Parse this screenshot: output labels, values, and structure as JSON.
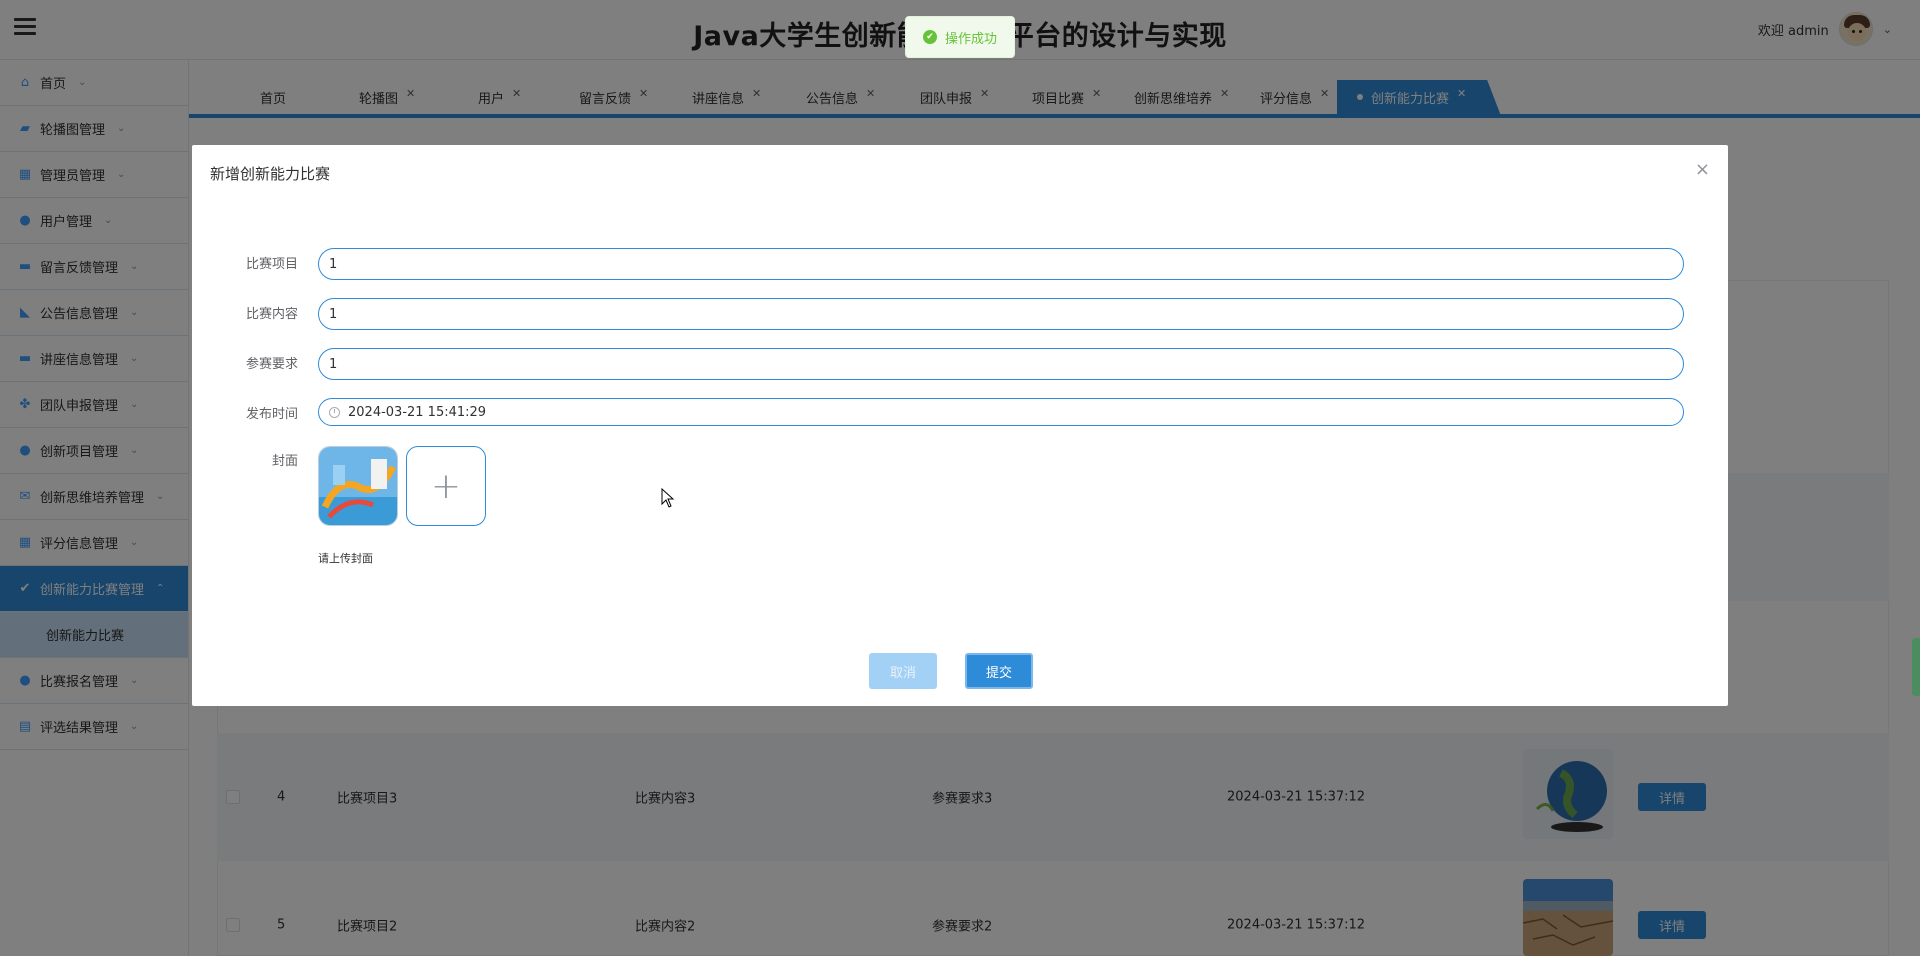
{
  "header": {
    "title": "Java大学生创新能力培养平台的设计与实现",
    "welcome": "欢迎 admin"
  },
  "toast": {
    "message": "操作成功"
  },
  "sidebar": {
    "items": [
      {
        "label": "首页",
        "icon": "home-icon"
      },
      {
        "label": "轮播图管理",
        "icon": "image-icon"
      },
      {
        "label": "管理员管理",
        "icon": "grid-icon"
      },
      {
        "label": "用户管理",
        "icon": "user-icon"
      },
      {
        "label": "留言反馈管理",
        "icon": "message-icon"
      },
      {
        "label": "公告信息管理",
        "icon": "megaphone-icon"
      },
      {
        "label": "讲座信息管理",
        "icon": "book-icon"
      },
      {
        "label": "团队申报管理",
        "icon": "team-icon"
      },
      {
        "label": "创新项目管理",
        "icon": "lightbulb-icon"
      },
      {
        "label": "创新思维培养管理",
        "icon": "mail-icon"
      },
      {
        "label": "评分信息管理",
        "icon": "dashboard-icon"
      },
      {
        "label": "创新能力比赛管理",
        "icon": "check-circle-icon"
      },
      {
        "label": "比赛报名管理",
        "icon": "drop-icon"
      },
      {
        "label": "评选结果管理",
        "icon": "table-icon"
      }
    ],
    "active_sub": "创新能力比赛"
  },
  "tabs": [
    {
      "label": "首页"
    },
    {
      "label": "轮播图"
    },
    {
      "label": "用户"
    },
    {
      "label": "留言反馈"
    },
    {
      "label": "讲座信息"
    },
    {
      "label": "公告信息"
    },
    {
      "label": "团队申报"
    },
    {
      "label": "项目比赛"
    },
    {
      "label": "创新思维培养"
    },
    {
      "label": "评分信息"
    },
    {
      "label": "创新能力比赛"
    }
  ],
  "table": {
    "rows": [
      {
        "index": "4",
        "project": "比赛项目3",
        "content": "比赛内容3",
        "requirement": "参赛要求3",
        "time": "2024-03-21 15:37:12",
        "action": "详情"
      },
      {
        "index": "5",
        "project": "比赛项目2",
        "content": "比赛内容2",
        "requirement": "参赛要求2",
        "time": "2024-03-21 15:37:12",
        "action": "详情"
      }
    ]
  },
  "dialog": {
    "title": "新增创新能力比赛",
    "fields": {
      "project": {
        "label": "比赛项目",
        "value": "1"
      },
      "content": {
        "label": "比赛内容",
        "value": "1"
      },
      "requirement": {
        "label": "参赛要求",
        "value": "1"
      },
      "publish_time": {
        "label": "发布时间",
        "value": "2024-03-21 15:41:29"
      },
      "cover": {
        "label": "封面",
        "tip": "请上传封面"
      }
    },
    "cancel": "取消",
    "submit": "提交"
  }
}
